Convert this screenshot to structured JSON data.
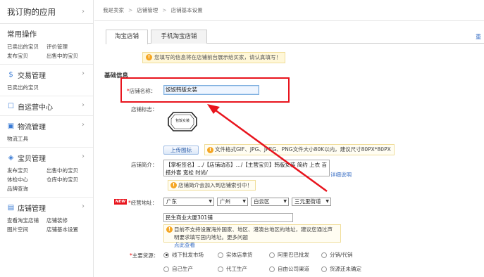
{
  "sidebar": {
    "top_title": "我订购的应用",
    "common_title": "常用操作",
    "common_links": [
      "已卖出的宝贝",
      "评价管理",
      "发布宝贝",
      "出售中的宝贝"
    ],
    "sections": [
      {
        "icon": "currency-icon",
        "glyph": "$",
        "title": "交易管理",
        "links": [
          "已卖出的宝贝"
        ]
      },
      {
        "icon": "chat-icon",
        "glyph": "☐",
        "title": "自运营中心",
        "links": []
      },
      {
        "icon": "truck-icon",
        "glyph": "▣",
        "title": "物流管理",
        "links": [
          "物流工具"
        ]
      },
      {
        "icon": "gift-icon",
        "glyph": "◈",
        "title": "宝贝管理",
        "links": [
          "发布宝贝",
          "出售中的宝贝",
          "体检中心",
          "仓库中的宝贝",
          "品牌查询"
        ]
      },
      {
        "icon": "store-icon",
        "glyph": "▤",
        "title": "店铺管理",
        "links": [
          "查看淘宝店铺",
          "店铺装修",
          "图片空间",
          "店铺基本设置"
        ]
      }
    ]
  },
  "breadcrumb": [
    "我是卖家",
    "店铺管理",
    "店铺基本设置"
  ],
  "tabs": [
    "淘宝店铺",
    "手机淘宝店铺"
  ],
  "tab_right_label": "重",
  "notice": "您填写的信息将在店铺前台展示给买家，请认真填写！",
  "section_title": "基础信息",
  "fields": {
    "name_label": "店铺名称：",
    "name_value": "饭饭韩版女装",
    "logo_label": "店铺标志：",
    "logo_text": "包饭女装",
    "upload_button": "上传图标",
    "upload_tip": "文件格式GIF、JPG、JPEG、PNG文件大小80K以内，建议尺寸80PX*80PX",
    "desc_label": "店铺简介：",
    "desc_value": "【掌柜签名】.../【店铺动态】.../【主营宝贝】韩版女装 简约 上衣 百搭外套 宽松 时尚/",
    "detail_link": "详细说明",
    "desc_tip": "店铺简介会加入到店铺索引中！",
    "new_badge": "NEW",
    "address_label": "经营地址：",
    "address_selects": [
      "广东",
      "广州",
      "白云区",
      "三元里街道"
    ],
    "address_value": "民生商业大厦301铺",
    "address_tip": "目前不支持设置海外国家、地区、港澳台地区的地址，建议您通",
    "address_tip2": "过声明要求填写国内地址。更多问题",
    "address_tip_link": "点此查看",
    "source_label": "主要货源：",
    "source_options": [
      "线下批发市场",
      "实体店拿货",
      "阿里巴巴批发",
      "分销/代销",
      "自己生产",
      "代工生产",
      "自由公司渠道",
      "货源还未确定"
    ],
    "source_selected": 0
  },
  "colors": {
    "highlight": "#e8141d",
    "link": "#3a6fc4"
  }
}
